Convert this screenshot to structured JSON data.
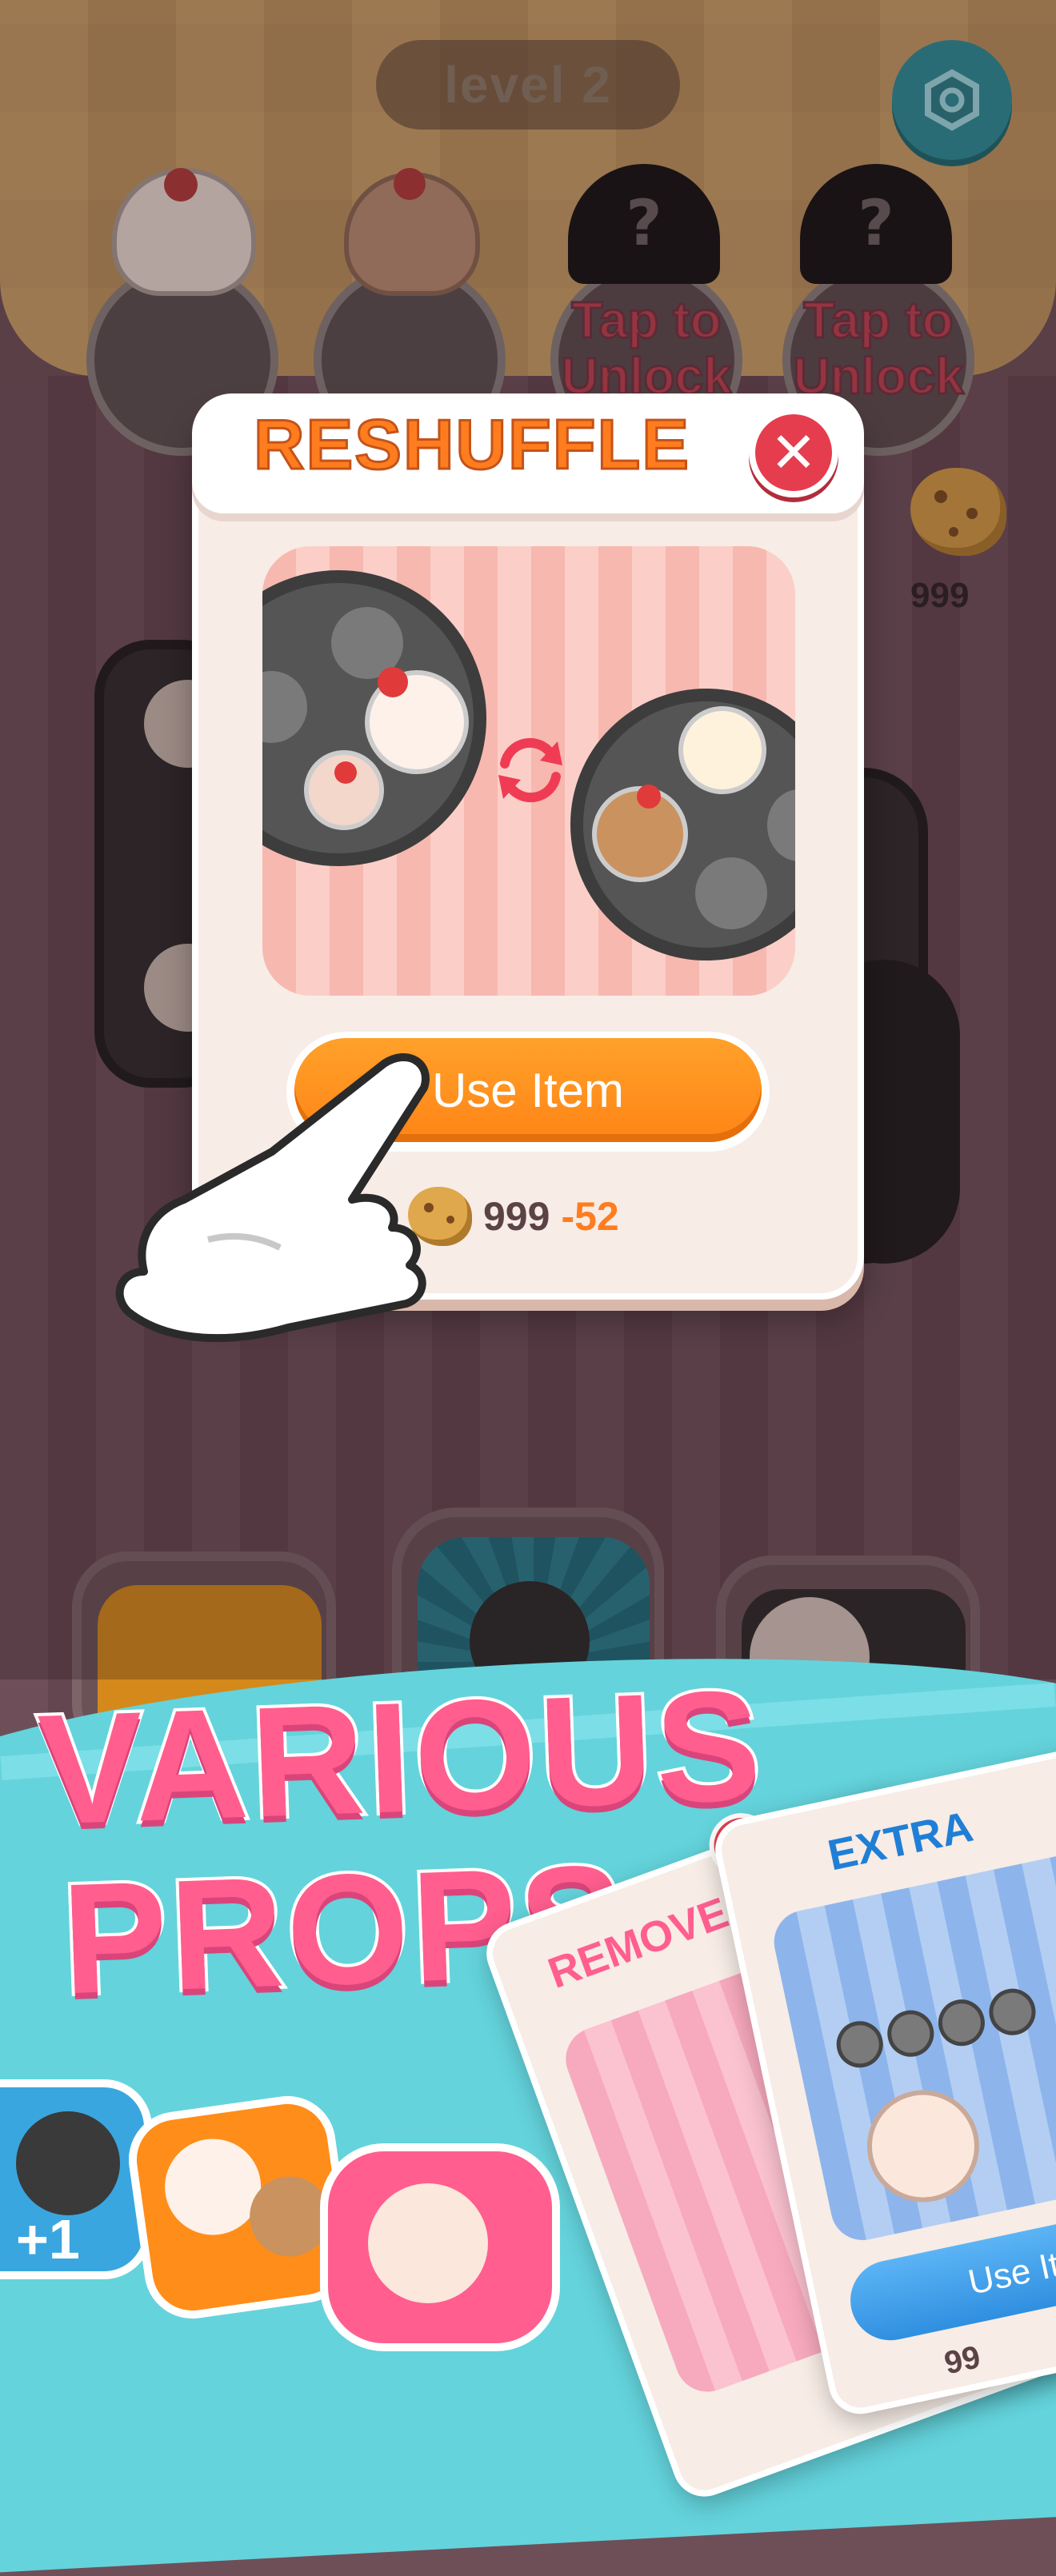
{
  "header": {
    "level_label": "level 2",
    "settings_icon": "hex-nut-icon"
  },
  "top_plates": [
    {
      "state": "unlocked"
    },
    {
      "state": "unlocked"
    },
    {
      "state": "locked",
      "badge": "?",
      "label": "Tap to Unlock"
    },
    {
      "state": "locked",
      "badge": "?",
      "label": "Tap to Unlock"
    }
  ],
  "currency": {
    "icon": "cookie-icon",
    "amount": "999"
  },
  "modal": {
    "title": "RESHUFFLE",
    "close_icon": "close-x-icon",
    "preview_icon": "swap-arrows-icon",
    "button_label": "Use Item",
    "cost_have": "999",
    "cost_change": "-52"
  },
  "banner": {
    "headline_line1": "VARIOUS",
    "headline_line2": "PROPS",
    "cards": [
      {
        "label": "REMOVE"
      },
      {
        "label": "EXTRA",
        "button_label": "Use Ite",
        "cost": "99"
      }
    ]
  },
  "colors": {
    "accent_orange": "#ff8416",
    "close_red": "#e63d4e",
    "headline_pink": "#ff5e8f",
    "banner_teal": "#64d3dc",
    "settings_teal": "#2c8e97"
  }
}
